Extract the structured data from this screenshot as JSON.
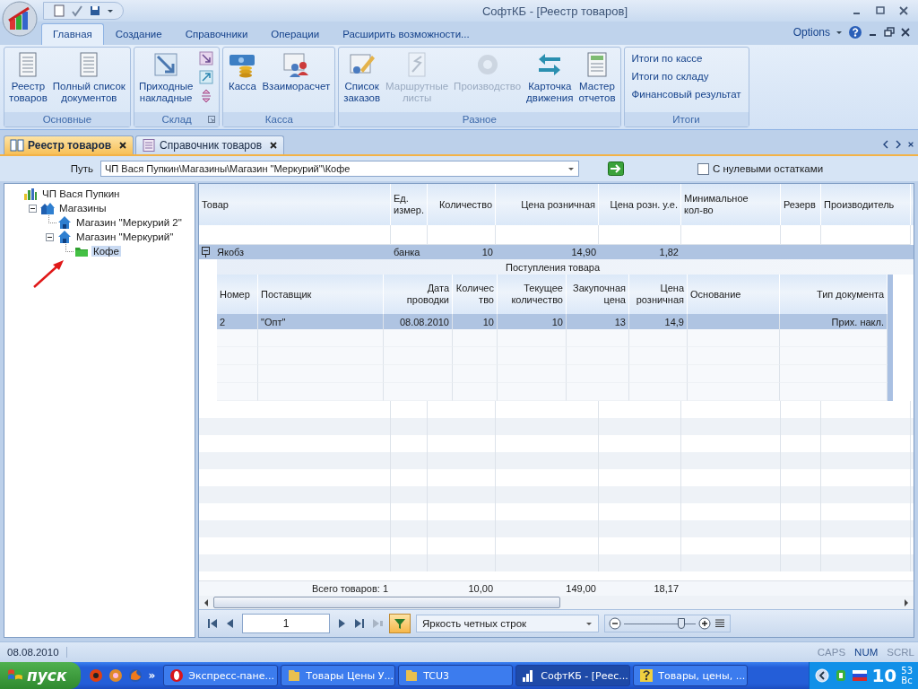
{
  "window": {
    "title": "СофтКБ - [Реестр товаров]"
  },
  "ribbon": {
    "tabs": [
      {
        "label": "Главная",
        "selected": true
      },
      {
        "label": "Создание",
        "selected": false
      },
      {
        "label": "Справочники",
        "selected": false
      },
      {
        "label": "Операции",
        "selected": false
      },
      {
        "label": "Расширить возможности...",
        "selected": false
      }
    ],
    "options": "Options",
    "groups": [
      {
        "label": "Основные",
        "buttons": [
          {
            "label": "Реестр\nтоваров",
            "disabled": false
          },
          {
            "label": "Полный список\nдокументов",
            "disabled": false
          }
        ]
      },
      {
        "label": "Склад",
        "buttons": [
          {
            "label": "Приходные\nнакладные",
            "disabled": false
          }
        ]
      },
      {
        "label": "Касса",
        "buttons": [
          {
            "label": "Касса",
            "disabled": false
          },
          {
            "label": "Взаиморасчет",
            "disabled": false
          }
        ]
      },
      {
        "label": "Разное",
        "buttons": [
          {
            "label": "Список\nзаказов",
            "disabled": false
          },
          {
            "label": "Маршрутные\nлисты",
            "disabled": true
          },
          {
            "label": "Производство",
            "disabled": true
          },
          {
            "label": "Карточка\nдвижения",
            "disabled": false
          },
          {
            "label": "Мастер\nотчетов",
            "disabled": false
          }
        ]
      },
      {
        "label": "Итоги",
        "links": [
          "Итоги по кассе",
          "Итоги по складу",
          "Финансовый результат"
        ]
      }
    ]
  },
  "doc_tabs": [
    {
      "label": "Реестр товаров",
      "selected": true
    },
    {
      "label": "Справочник товаров",
      "selected": false
    }
  ],
  "path": {
    "label": "Путь",
    "value": "ЧП Вася Пупкин\\Магазины\\Магазин \"Меркурий\"\\Кофе",
    "zero_rest": {
      "label": "С нулевыми остатками",
      "checked": false
    }
  },
  "tree": [
    {
      "label": "ЧП Вася Пупкин",
      "kind": "org",
      "selected": false,
      "children": [
        {
          "label": "Магазины",
          "kind": "group",
          "expanded": true,
          "selected": false,
          "children": [
            {
              "label": "Магазин \"Меркурий 2\"",
              "kind": "store",
              "selected": false
            },
            {
              "label": "Магазин \"Меркурий\"",
              "kind": "store",
              "expanded": true,
              "selected": false,
              "children": [
                {
                  "label": "Кофе",
                  "kind": "folder",
                  "selected": true
                }
              ]
            }
          ]
        }
      ]
    }
  ],
  "grid": {
    "columns": [
      "Товар",
      "Ед.\nизмер.",
      "Количество",
      "Цена розничная",
      "Цена розн. у.е.",
      "Минимальное\nкол-во",
      "Резерв",
      "Производитель"
    ],
    "rows": [
      {
        "cells": [
          "Якобз",
          "банка",
          "10",
          "14,90",
          "1,82"
        ],
        "expanded": true,
        "selected": true,
        "detail": {
          "caption": "Поступления товара",
          "columns": [
            "Номер",
            "Поставщик",
            "Дата\nпроводки",
            "Количество",
            "Текущее\nколичество",
            "Закупочная\nцена",
            "Цена\nрозничная",
            "Основание",
            "Тип документа"
          ],
          "rows": [
            {
              "cells": [
                "2",
                "\"Опт\"",
                "08.08.2010",
                "10",
                "10",
                "13",
                "14,9",
                "",
                "Прих. накл."
              ],
              "selected": true
            }
          ]
        }
      }
    ],
    "footer": [
      "Всего товаров: 1",
      "10,00",
      "149,00",
      "18,17"
    ]
  },
  "nav": {
    "page": "1",
    "filter_on": true,
    "brightness": "Яркость четных строк",
    "zoom": {
      "level": 0.8
    }
  },
  "status": {
    "date": "08.08.2010",
    "indicators": [
      {
        "label": "CAPS",
        "on": false
      },
      {
        "label": "NUM",
        "on": true
      },
      {
        "label": "SCRL",
        "on": false
      }
    ]
  },
  "taskbar": {
    "start": "пуск",
    "more": "»",
    "tasks": [
      {
        "label": "Экспресс-пане...",
        "selected": false
      },
      {
        "label": "Товары Цены У...",
        "selected": false
      },
      {
        "label": "TCU3",
        "selected": false
      },
      {
        "label": "СофтКБ - [Реес...",
        "selected": true
      },
      {
        "label": "Товары, цены, ...",
        "selected": false
      }
    ],
    "clock": {
      "hours": "10",
      "minutes": "53",
      "day": "Вс"
    }
  }
}
